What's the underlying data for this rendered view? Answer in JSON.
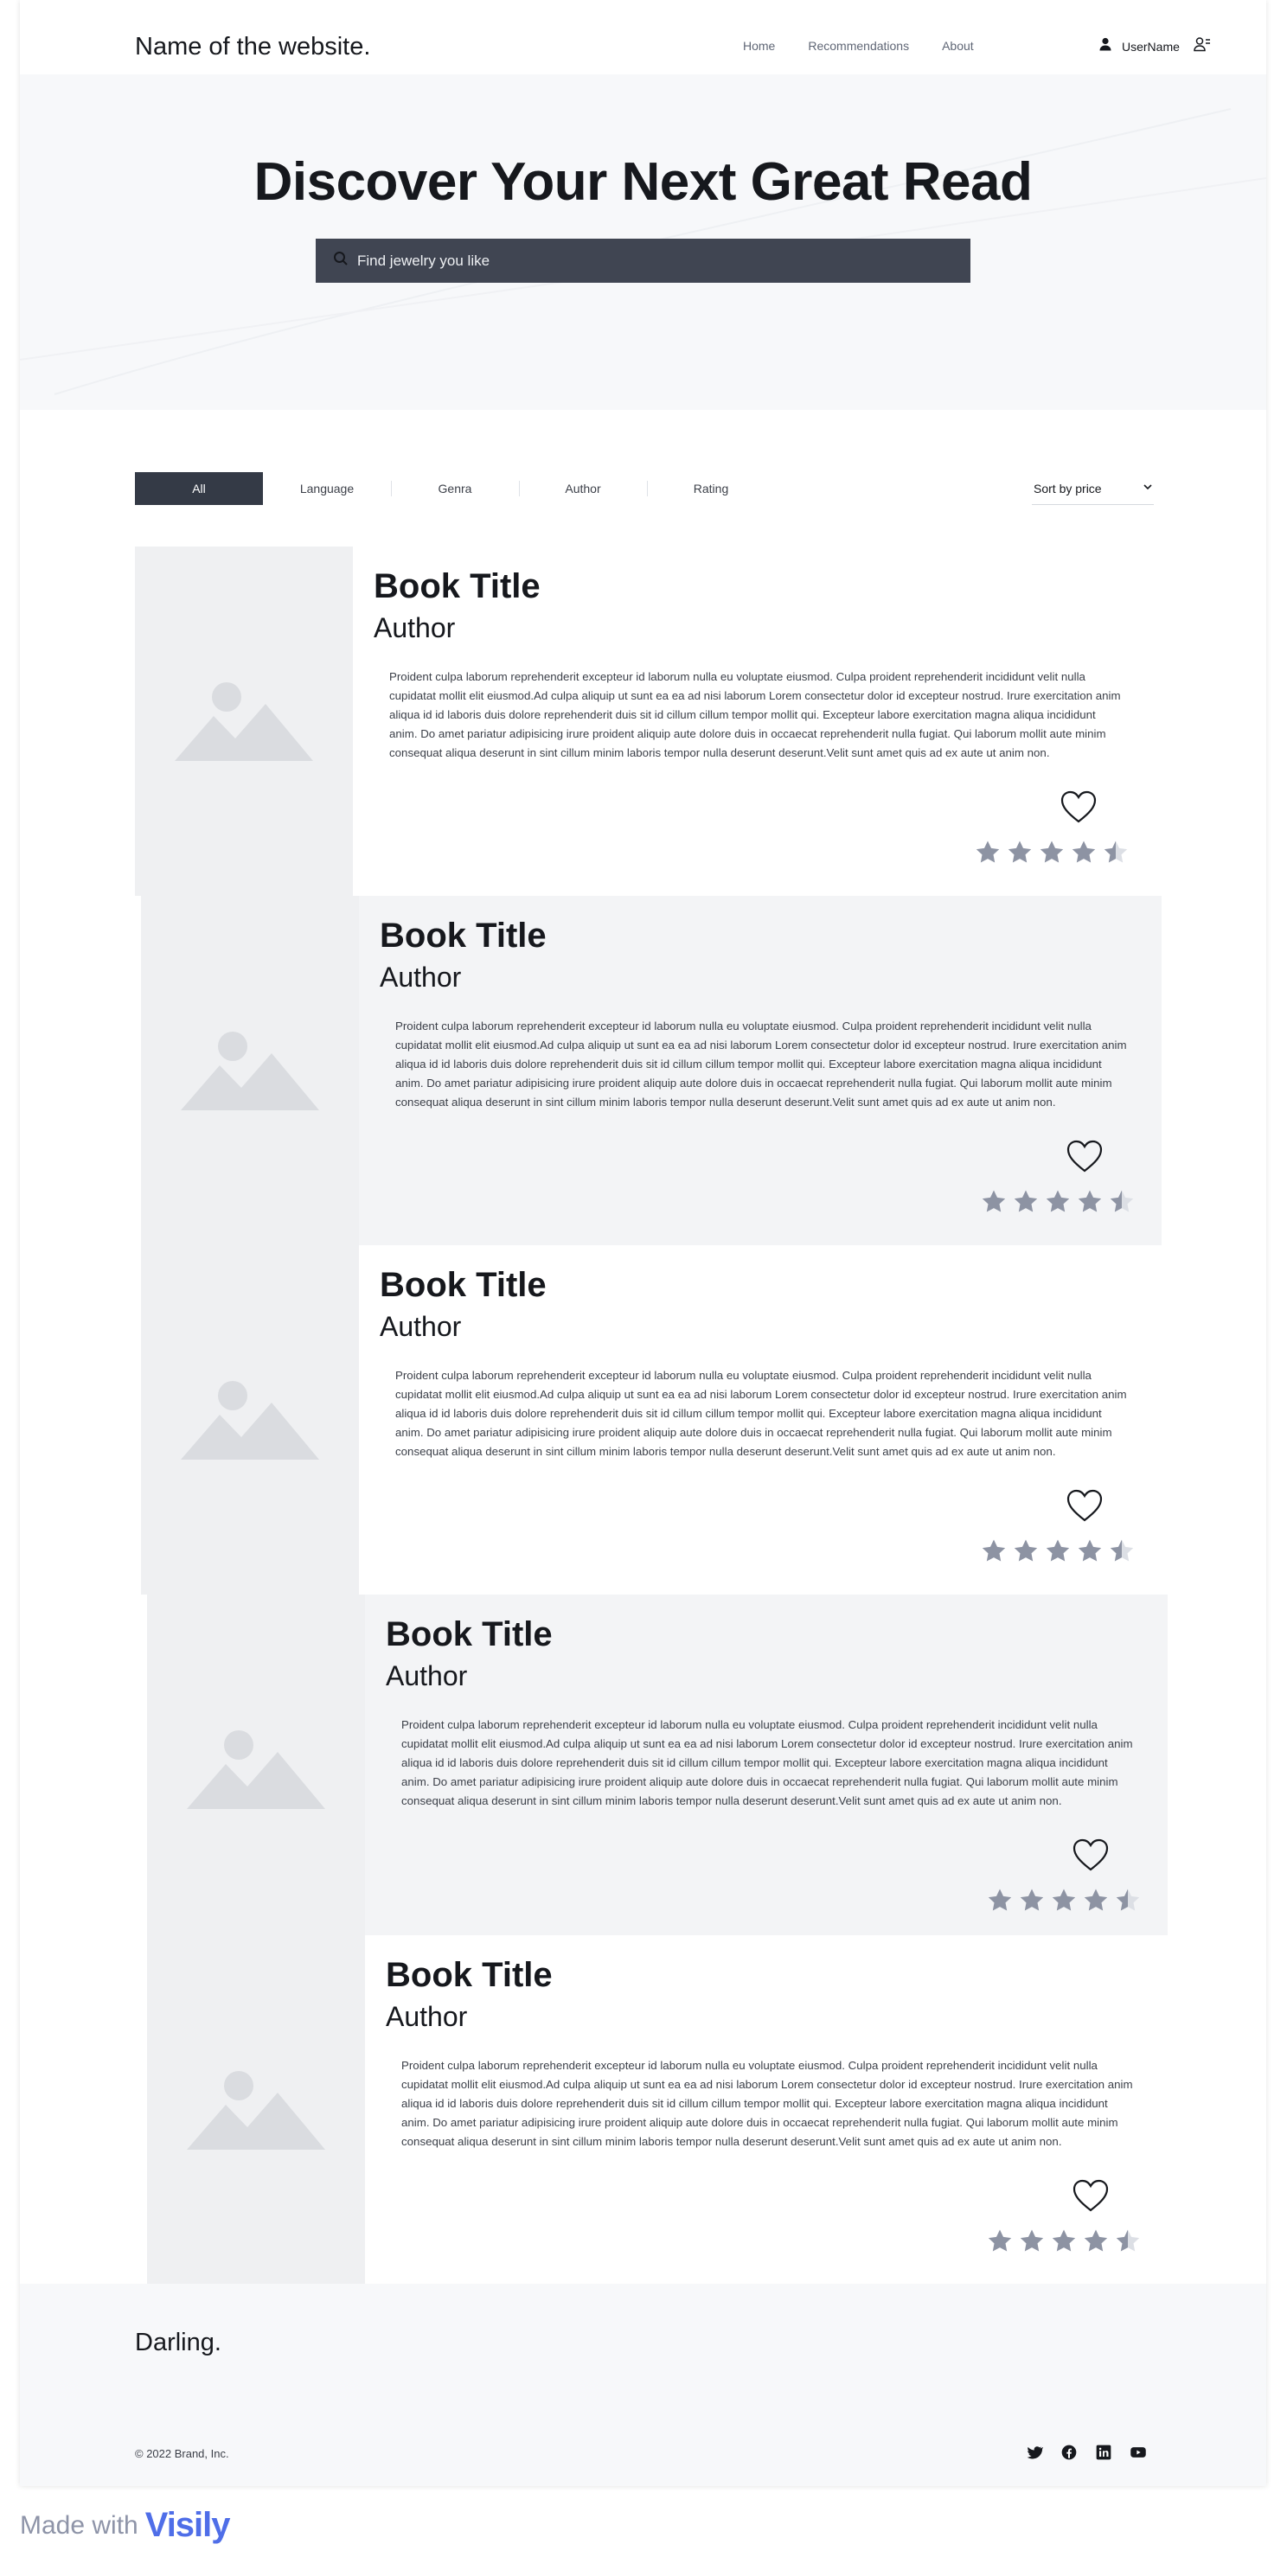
{
  "header": {
    "site_name": "Name of the website.",
    "nav": [
      "Home",
      "Recommendations",
      "About"
    ],
    "username": "UserName"
  },
  "hero": {
    "title": "Discover Your Next Great Read",
    "search_placeholder": "Find jewelry you like"
  },
  "filters": {
    "tabs": [
      "All",
      "Language",
      "Genra",
      "Author",
      "Rating"
    ],
    "active_tab": "All",
    "sort_label": "Sort by price"
  },
  "books": [
    {
      "title": "Book Title",
      "author": "Author",
      "description": "Proident culpa laborum reprehenderit excepteur id laborum nulla eu voluptate eiusmod. Culpa proident reprehenderit incididunt velit nulla cupidatat mollit elit eiusmod.Ad culpa aliquip ut sunt ea ea ad nisi laborum Lorem consectetur dolor id excepteur nostrud. Irure exercitation anim aliqua id id laboris duis dolore reprehenderit duis sit id cillum cillum tempor mollit qui. Excepteur labore exercitation magna aliqua incididunt anim. Do amet pariatur adipisicing irure proident aliquip aute dolore duis in occaecat reprehenderit nulla fugiat. Qui laborum mollit aute minim consequat aliqua deserunt in sint cillum minim laboris tempor nulla deserunt deserunt.Velit sunt amet quis ad ex aute ut anim non.",
      "rating": 4.5
    },
    {
      "title": "Book Title",
      "author": "Author",
      "description": "Proident culpa laborum reprehenderit excepteur id laborum nulla eu voluptate eiusmod. Culpa proident reprehenderit incididunt velit nulla cupidatat mollit elit eiusmod.Ad culpa aliquip ut sunt ea ea ad nisi laborum Lorem consectetur dolor id excepteur nostrud. Irure exercitation anim aliqua id id laboris duis dolore reprehenderit duis sit id cillum cillum tempor mollit qui. Excepteur labore exercitation magna aliqua incididunt anim. Do amet pariatur adipisicing irure proident aliquip aute dolore duis in occaecat reprehenderit nulla fugiat. Qui laborum mollit aute minim consequat aliqua deserunt in sint cillum minim laboris tempor nulla deserunt deserunt.Velit sunt amet quis ad ex aute ut anim non.",
      "rating": 4.5
    },
    {
      "title": "Book Title",
      "author": "Author",
      "description": "Proident culpa laborum reprehenderit excepteur id laborum nulla eu voluptate eiusmod. Culpa proident reprehenderit incididunt velit nulla cupidatat mollit elit eiusmod.Ad culpa aliquip ut sunt ea ea ad nisi laborum Lorem consectetur dolor id excepteur nostrud. Irure exercitation anim aliqua id id laboris duis dolore reprehenderit duis sit id cillum cillum tempor mollit qui. Excepteur labore exercitation magna aliqua incididunt anim. Do amet pariatur adipisicing irure proident aliquip aute dolore duis in occaecat reprehenderit nulla fugiat. Qui laborum mollit aute minim consequat aliqua deserunt in sint cillum minim laboris tempor nulla deserunt deserunt.Velit sunt amet quis ad ex aute ut anim non.",
      "rating": 4.5
    },
    {
      "title": "Book Title",
      "author": "Author",
      "description": "Proident culpa laborum reprehenderit excepteur id laborum nulla eu voluptate eiusmod. Culpa proident reprehenderit incididunt velit nulla cupidatat mollit elit eiusmod.Ad culpa aliquip ut sunt ea ea ad nisi laborum Lorem consectetur dolor id excepteur nostrud. Irure exercitation anim aliqua id id laboris duis dolore reprehenderit duis sit id cillum cillum tempor mollit qui. Excepteur labore exercitation magna aliqua incididunt anim. Do amet pariatur adipisicing irure proident aliquip aute dolore duis in occaecat reprehenderit nulla fugiat. Qui laborum mollit aute minim consequat aliqua deserunt in sint cillum minim laboris tempor nulla deserunt deserunt.Velit sunt amet quis ad ex aute ut anim non.",
      "rating": 4.5
    },
    {
      "title": "Book Title",
      "author": "Author",
      "description": "Proident culpa laborum reprehenderit excepteur id laborum nulla eu voluptate eiusmod. Culpa proident reprehenderit incididunt velit nulla cupidatat mollit elit eiusmod.Ad culpa aliquip ut sunt ea ea ad nisi laborum Lorem consectetur dolor id excepteur nostrud. Irure exercitation anim aliqua id id laboris duis dolore reprehenderit duis sit id cillum cillum tempor mollit qui. Excepteur labore exercitation magna aliqua incididunt anim. Do amet pariatur adipisicing irure proident aliquip aute dolore duis in occaecat reprehenderit nulla fugiat. Qui laborum mollit aute minim consequat aliqua deserunt in sint cillum minim laboris tempor nulla deserunt deserunt.Velit sunt amet quis ad ex aute ut anim non.",
      "rating": 4.5
    }
  ],
  "footer": {
    "brand": "Darling.",
    "copyright": "© 2022 Brand, Inc.",
    "socials": [
      "twitter-icon",
      "facebook-icon",
      "linkedin-icon",
      "youtube-icon"
    ]
  },
  "badge": {
    "made_with": "Made with",
    "brand": "Visily"
  },
  "colors": {
    "accent": "#343a46",
    "search_bg": "#404552",
    "star": "#8d93a3",
    "star_empty": "#dcdfe5",
    "placeholder_bg": "#eff0f2",
    "hero_bg": "#f7f8fa",
    "visily": "#4f6ee8"
  }
}
